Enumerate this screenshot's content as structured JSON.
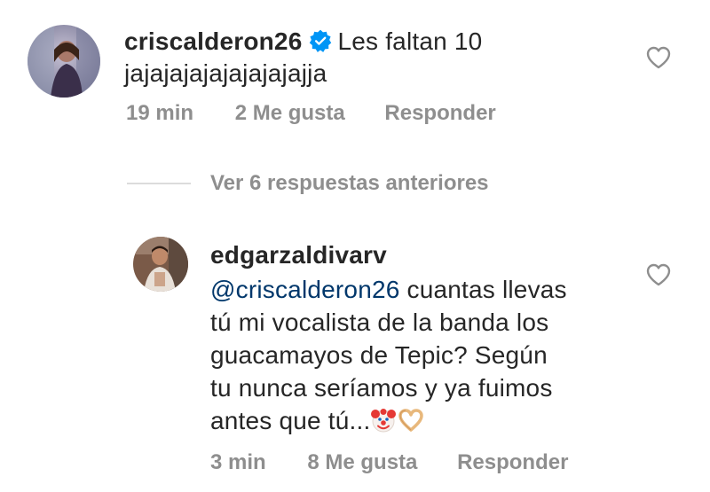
{
  "comment": {
    "username": "criscalderon26",
    "verified": true,
    "text_line1": "Les faltan 10",
    "text_line2": "jajajajajajajajajajja",
    "time": "19 min",
    "likes": "2 Me gusta",
    "reply_label": "Responder"
  },
  "view_replies": {
    "label": "Ver 6 respuestas anteriores"
  },
  "reply": {
    "username": "edgarzaldivarv",
    "mention": "@criscalderon26",
    "line1_rest": " cuantas llevas",
    "line2": "tú mi vocalista de la banda los",
    "line3": "guacamayos de Tepic? Según",
    "line4": "tu nunca seríamos y ya fuimos",
    "line5": "antes que tú...",
    "emojis": [
      "clown-face-icon",
      "heart-hands-icon"
    ],
    "time": "3 min",
    "likes": "8 Me gusta",
    "reply_label": "Responder"
  },
  "colors": {
    "text": "#262626",
    "meta": "#8e8e8e",
    "mention": "#00376b",
    "verified": "#0095f6",
    "divider": "#dbdbdb"
  }
}
